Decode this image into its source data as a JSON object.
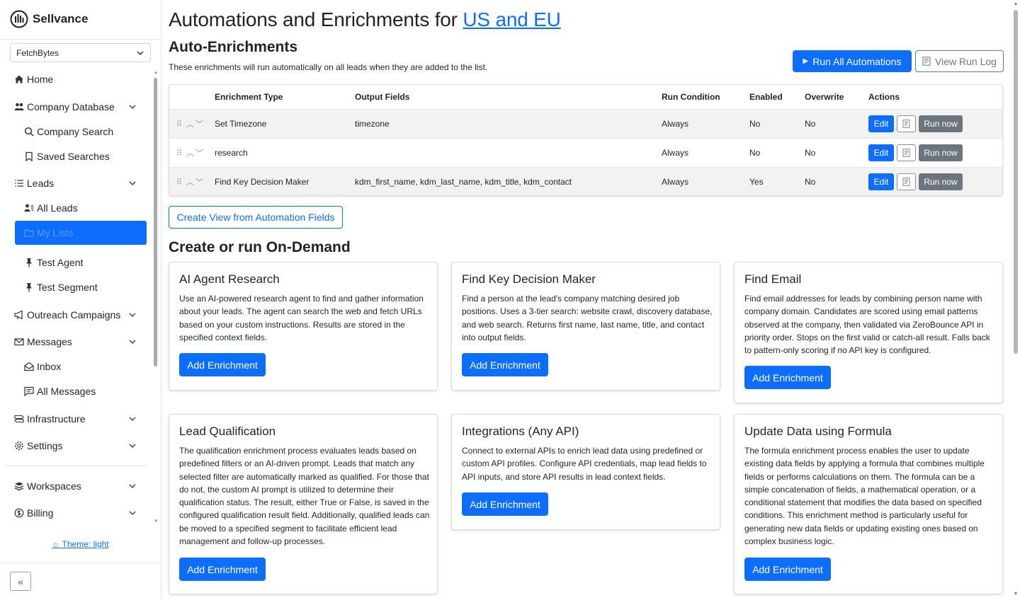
{
  "brand": {
    "name": "Sellvance"
  },
  "workspace_select": {
    "value": "FetchBytes"
  },
  "sidebar": {
    "home": "Home",
    "company_database": "Company Database",
    "company_search": "Company Search",
    "saved_searches": "Saved Searches",
    "leads": "Leads",
    "all_leads": "All Leads",
    "my_lists": "My Lists",
    "test_agent": "Test Agent",
    "test_segment": "Test Segment",
    "outreach_campaigns": "Outreach Campaigns",
    "messages": "Messages",
    "inbox": "Inbox",
    "all_messages": "All Messages",
    "infrastructure": "Infrastructure",
    "settings": "Settings",
    "workspaces": "Workspaces",
    "billing": "Billing",
    "theme": "Theme: light"
  },
  "header": {
    "title_prefix": "Automations and Enrichments for ",
    "title_link": "US and EU"
  },
  "auto_enrichments": {
    "title": "Auto-Enrichments",
    "subtitle": "These enrichments will run automatically on all leads when they are added to the list.",
    "run_all_label": "Run All Automations",
    "view_log_label": "View Run Log",
    "columns": [
      "Enrichment Type",
      "Output Fields",
      "Run Condition",
      "Enabled",
      "Overwrite",
      "Actions"
    ],
    "rows": [
      {
        "type": "Set Timezone",
        "output": "timezone",
        "condition": "Always",
        "enabled": "No",
        "overwrite": "No"
      },
      {
        "type": "research",
        "output": "",
        "condition": "Always",
        "enabled": "No",
        "overwrite": "No"
      },
      {
        "type": "Find Key Decision Maker",
        "output": "kdm_first_name, kdm_last_name, kdm_title, kdm_contact",
        "condition": "Always",
        "enabled": "Yes",
        "overwrite": "No"
      }
    ],
    "edit_label": "Edit",
    "run_now_label": "Run now",
    "create_view_label": "Create View from Automation Fields"
  },
  "on_demand": {
    "title": "Create or run On-Demand",
    "add_label": "Add Enrichment",
    "cards": [
      {
        "title": "AI Agent Research",
        "desc": "Use an AI-powered research agent to find and gather information about your leads. The agent can search the web and fetch URLs based on your custom instructions. Results are stored in the specified context fields."
      },
      {
        "title": "Find Key Decision Maker",
        "desc": "Find a person at the lead's company matching desired job positions. Uses a 3-tier search: website crawl, discovery database, and web search. Returns first name, last name, title, and contact into output fields."
      },
      {
        "title": "Find Email",
        "desc": "Find email addresses for leads by combining person name with company domain. Candidates are scored using email patterns observed at the company, then validated via ZeroBounce API in priority order. Stops on the first valid or catch-all result. Falls back to pattern-only scoring if no API key is configured."
      },
      {
        "title": "Lead Qualification",
        "desc": "The qualification enrichment process evaluates leads based on predefined filters or an AI-driven prompt. Leads that match any selected filter are automatically marked as qualified. For those that do not, the custom AI prompt is utilized to determine their qualification status. The result, either True or False, is saved in the configured qualification result field. Additionally, qualified leads can be moved to a specified segment to facilitate efficient lead management and follow-up processes."
      },
      {
        "title": "Integrations (Any API)",
        "desc": "Connect to external APIs to enrich lead data using predefined or custom API profiles. Configure API credentials, map lead fields to API inputs, and store API results in lead context fields."
      },
      {
        "title": "Update Data using Formula",
        "desc": "The formula enrichment process enables the user to update existing data fields by applying a formula that combines multiple fields or performs calculations on them. The formula can be a simple concatenation of fields, a mathematical operation, or a conditional statement that modifies the data based on specified conditions. This enrichment method is particularly useful for generating new data fields or updating existing ones based on complex business logic."
      }
    ]
  },
  "colors": {
    "accent": "#0d6efd",
    "secondary": "#6c757d"
  }
}
